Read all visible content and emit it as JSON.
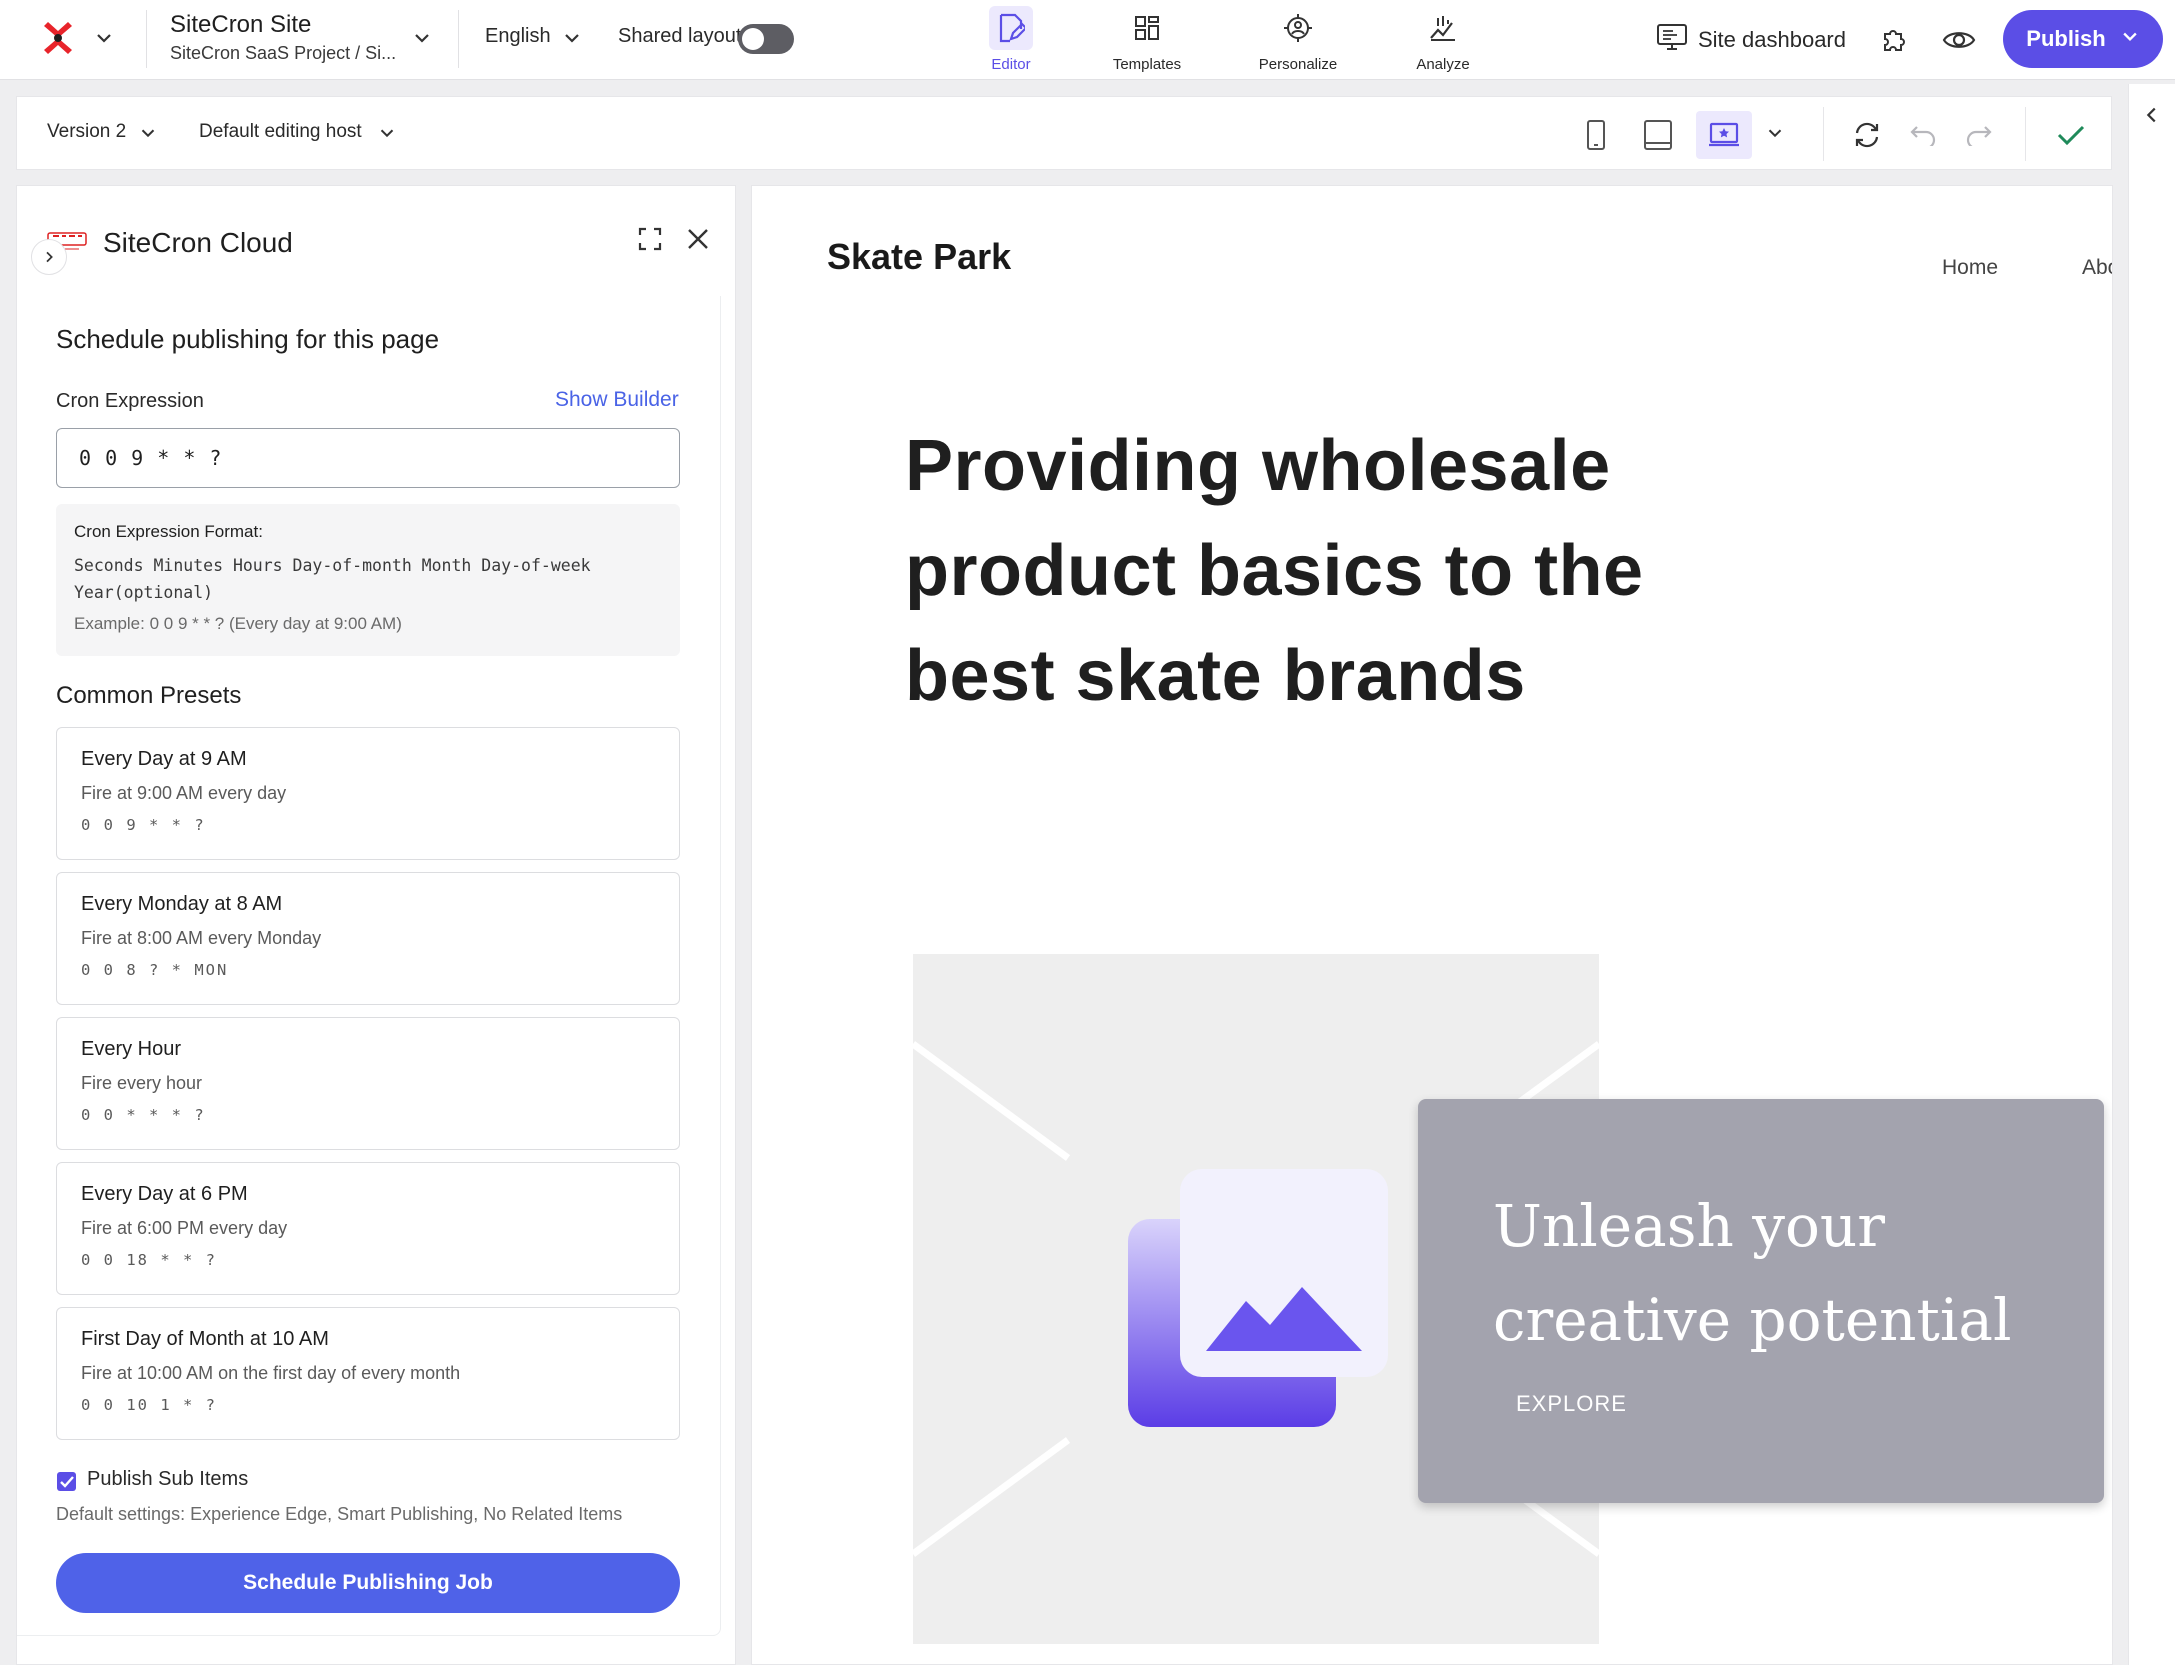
{
  "topbar": {
    "site_title": "SiteCron Site",
    "site_subtitle": "SiteCron SaaS Project / Si...",
    "language": "English",
    "shared_layout_label": "Shared layout",
    "shared_layout_on": false,
    "tabs": [
      {
        "label": "Editor",
        "icon": "edit-page-icon",
        "active": true
      },
      {
        "label": "Templates",
        "icon": "templates-grid-icon",
        "active": false
      },
      {
        "label": "Personalize",
        "icon": "personalize-target-icon",
        "active": false
      },
      {
        "label": "Analyze",
        "icon": "analyze-chart-icon",
        "active": false
      }
    ],
    "site_dashboard_label": "Site dashboard",
    "publish_label": "Publish"
  },
  "toolbar": {
    "version_label": "Version 2",
    "editing_host_label": "Default editing host"
  },
  "panel": {
    "title": "SiteCron Cloud",
    "heading": "Schedule publishing for this page",
    "cron_label": "Cron Expression",
    "show_builder": "Show Builder",
    "cron_value": "0 0 9 * * ?",
    "format": {
      "title": "Cron Expression Format:",
      "fields": "Seconds Minutes Hours Day-of-month Month Day-of-week",
      "optional": "Year(optional)",
      "example": "Example: 0 0 9 * * ? (Every day at 9:00 AM)"
    },
    "presets_heading": "Common Presets",
    "presets": [
      {
        "name": "Every Day at 9 AM",
        "desc": "Fire at 9:00 AM every day",
        "cron": "0 0 9 * * ?"
      },
      {
        "name": "Every Monday at 8 AM",
        "desc": "Fire at 8:00 AM every Monday",
        "cron": "0 0 8 ? * MON"
      },
      {
        "name": "Every Hour",
        "desc": "Fire every hour",
        "cron": "0 0 * * * ?"
      },
      {
        "name": "Every Day at 6 PM",
        "desc": "Fire at 6:00 PM every day",
        "cron": "0 0 18 * * ?"
      },
      {
        "name": "First Day of Month at 10 AM",
        "desc": "Fire at 10:00 AM on the first day of every month",
        "cron": "0 0 10 1 * ?"
      }
    ],
    "publish_sub_items_label": "Publish Sub Items",
    "publish_sub_items_checked": true,
    "defaults_text": "Default settings: Experience Edge, Smart Publishing, No Related Items",
    "schedule_button": "Schedule Publishing Job"
  },
  "preview": {
    "brand": "Skate Park",
    "nav": [
      "Home",
      "Abo"
    ],
    "hero": "Providing wholesale product basics to the best skate brands",
    "card_title": "Unleash your creative potential",
    "card_cta": "EXPLORE"
  },
  "colors": {
    "accent": "#5b4ee6",
    "button_blue": "#4f62e8",
    "link_blue": "#4a63e6",
    "card_gray": "#a3a3ae"
  }
}
